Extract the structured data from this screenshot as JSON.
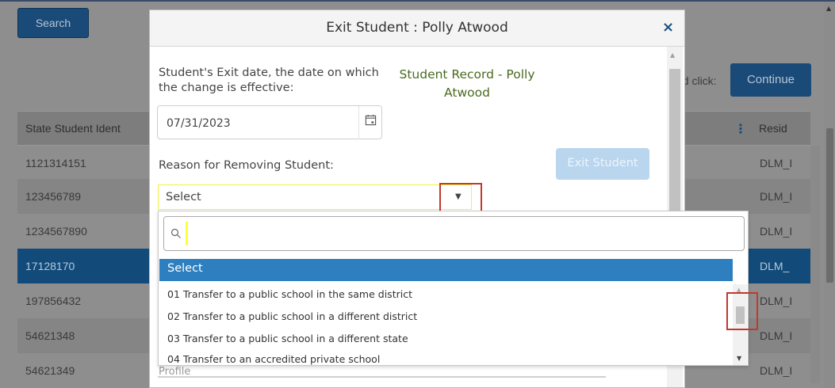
{
  "background": {
    "search_label": "Search",
    "instruction_text": "nd click:",
    "continue_label": "Continue",
    "table": {
      "col_left": "State Student Ident",
      "col_right": "Resid",
      "rows": [
        {
          "id": "1121314151",
          "res": "DLM_I",
          "selected": false
        },
        {
          "id": "123456789",
          "res": "DLM_I",
          "selected": false
        },
        {
          "id": "1234567890",
          "res": "DLM_I",
          "selected": false
        },
        {
          "id": "17128170",
          "res": "DLM_",
          "selected": true
        },
        {
          "id": "197856432",
          "res": "DLM_I",
          "selected": false
        },
        {
          "id": "54621348",
          "res": "DLM_I",
          "selected": false
        },
        {
          "id": "54621349",
          "res": "DLM_I",
          "selected": false
        }
      ]
    }
  },
  "modal": {
    "title": "Exit Student : Polly Atwood",
    "close_symbol": "×",
    "exit_date_label": "Student's Exit date, the date on which the change is effective:",
    "record_label": "Student Record - Polly Atwood",
    "exit_date_value": "07/31/2023",
    "reason_label": "Reason for Removing Student:",
    "exit_button_label": "Exit Student",
    "reason_select_value": "Select",
    "dropdown": {
      "search_value": "",
      "options": [
        {
          "label": "Select",
          "selected": true
        },
        {
          "label": "01 Transfer to a public school in the same district",
          "selected": false
        },
        {
          "label": "02 Transfer to a public school in a different district",
          "selected": false
        },
        {
          "label": "03 Transfer to a public school in a different state",
          "selected": false
        },
        {
          "label": "04 Transfer to an accredited private school",
          "selected": false
        }
      ]
    },
    "under_text": "Profile"
  },
  "colors": {
    "primary": "#124b7a",
    "selected_option": "#2d7fc0",
    "record_text": "#4a6a1f",
    "highlight_box": "#c0392b",
    "focus_yellow": "#f2f23a"
  }
}
